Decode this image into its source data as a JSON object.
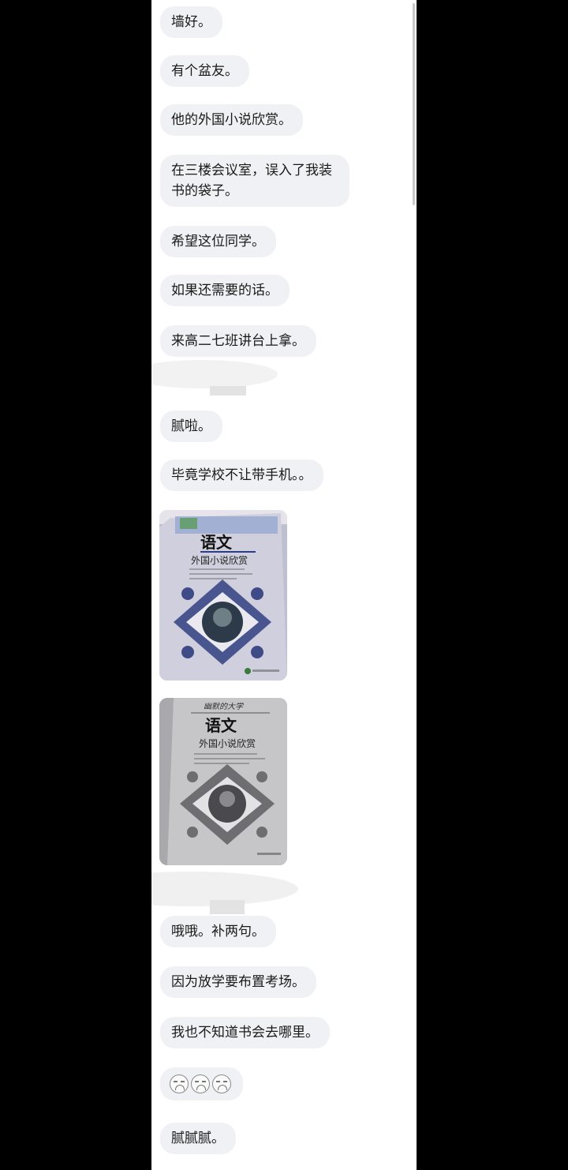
{
  "messages": [
    {
      "text": "墙好。"
    },
    {
      "text": "有个盆友。"
    },
    {
      "text": "他的外国小说欣赏。"
    },
    {
      "text": "在三楼会议室，误入了我装书的袋子。"
    },
    {
      "text": "希望这位同学。"
    },
    {
      "text": "如果还需要的话。"
    },
    {
      "text": "来高二七班讲台上拿。"
    },
    {
      "text": "腻啦。"
    },
    {
      "text": "毕竟学校不让带手机。。"
    },
    {
      "text": "哦哦。补两句。"
    },
    {
      "text": "因为放学要布置考场。"
    },
    {
      "text": "我也不知道书会去哪里。"
    },
    {
      "text": "腻腻腻。"
    }
  ],
  "book_photos": [
    {
      "title": "语文",
      "subtitle": "外国小说欣赏",
      "colors": {
        "cover": "#c9c8d8",
        "ornament": "#3f4b86",
        "band": "#6c86c2"
      }
    },
    {
      "handwritten": "幽默的大学",
      "title": "语文",
      "subtitle": "外国小说欣赏",
      "colors": {
        "cover": "#c4c3c6",
        "ornament": "#65656a"
      }
    }
  ],
  "emoji_row": {
    "icons": [
      "grimace-emoji",
      "grimace-emoji",
      "grimace-emoji"
    ]
  }
}
